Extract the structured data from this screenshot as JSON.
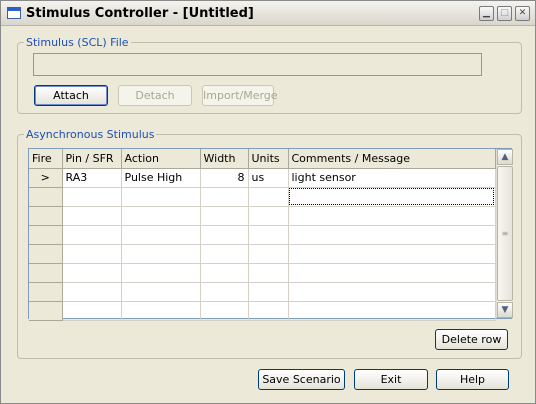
{
  "window": {
    "title": "Stimulus Controller - [Untitled]",
    "controls": {
      "minimize": "▁",
      "maximize": "□",
      "close": "✕"
    }
  },
  "scl_group": {
    "label": "Stimulus (SCL)  File",
    "file_value": "",
    "attach_label": "Attach",
    "detach_label": "Detach",
    "import_label": "Import/Merge"
  },
  "async_group": {
    "label": "Asynchronous Stimulus",
    "columns": [
      "Fire",
      "Pin / SFR",
      "Action",
      "Width",
      "Units",
      "Comments / Message"
    ],
    "rows": [
      {
        "fire": ">",
        "pin": "RA3",
        "action": "Pulse High",
        "width": "8",
        "units": "us",
        "comment": "light sensor"
      },
      {
        "fire": "",
        "pin": "",
        "action": "",
        "width": "",
        "units": "",
        "comment": ""
      },
      {
        "fire": "",
        "pin": "",
        "action": "",
        "width": "",
        "units": "",
        "comment": ""
      },
      {
        "fire": "",
        "pin": "",
        "action": "",
        "width": "",
        "units": "",
        "comment": ""
      },
      {
        "fire": "",
        "pin": "",
        "action": "",
        "width": "",
        "units": "",
        "comment": ""
      },
      {
        "fire": "",
        "pin": "",
        "action": "",
        "width": "",
        "units": "",
        "comment": ""
      },
      {
        "fire": "",
        "pin": "",
        "action": "",
        "width": "",
        "units": "",
        "comment": ""
      },
      {
        "fire": "",
        "pin": "",
        "action": "",
        "width": "",
        "units": "",
        "comment": ""
      }
    ],
    "scroll": {
      "up": "▲",
      "down": "▼",
      "grip": "≡"
    },
    "delete_row_label": "Delete row"
  },
  "footer": {
    "save_label": "Save Scenario",
    "exit_label": "Exit",
    "help_label": "Help"
  },
  "colors": {
    "group_label": "#1c4fb5",
    "window_bg": "#ece9d8",
    "grid_header": "#ece9d8"
  }
}
